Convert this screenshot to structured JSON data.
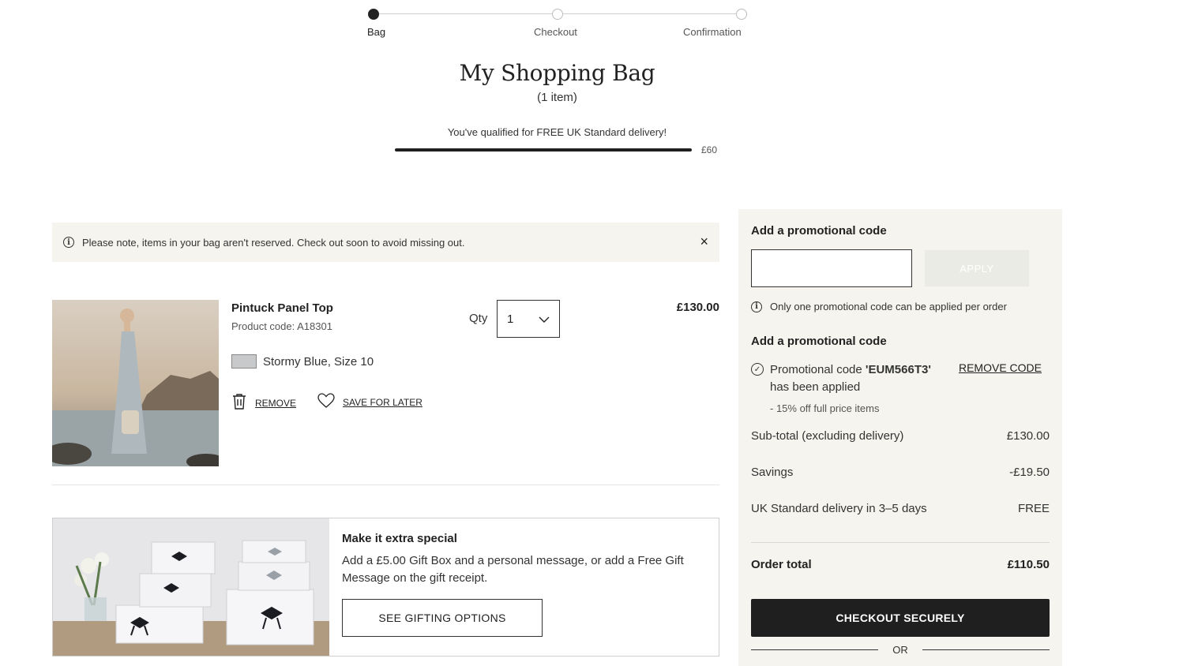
{
  "steps": [
    {
      "label": "Bag",
      "active": true
    },
    {
      "label": "Checkout",
      "active": false
    },
    {
      "label": "Confirmation",
      "active": false
    }
  ],
  "page": {
    "title": "My Shopping Bag",
    "item_count": "(1 item)"
  },
  "delivery": {
    "message": "You've qualified for FREE UK Standard delivery!",
    "threshold": "£60",
    "progress": 1.0
  },
  "notice": {
    "text": "Please note, items in your bag aren't reserved. Check out soon to avoid missing out.",
    "close_symbol": "×"
  },
  "product": {
    "name": "Pintuck Panel Top",
    "code": "Product code: A18301",
    "variant": "Stormy Blue, Size 10",
    "swatch_color": "#c7c9cb",
    "qty_label": "Qty",
    "qty_value": "1",
    "price": "£130.00",
    "remove_label": "REMOVE",
    "save_label": "SAVE FOR LATER"
  },
  "gift": {
    "title": "Make it extra special",
    "description": "Add a £5.00 Gift Box and a personal message, or add a Free Gift Message on the gift receipt.",
    "button_label": "SEE GIFTING OPTIONS"
  },
  "summary": {
    "promo_heading": "Add a promotional code",
    "promo_placeholder": "",
    "apply_label": "APPLY",
    "promo_note": "Only one promotional code can be applied per order",
    "applied_heading": "Add a promotional code",
    "applied_prefix": "Promotional code ",
    "applied_code": "'EUM566T3'",
    "applied_suffix": "has been applied",
    "remove_code_label": "REMOVE CODE",
    "discount_note": "- 15% off full price items",
    "rows": [
      {
        "label": "Sub-total (excluding delivery)",
        "value": "£130.00"
      },
      {
        "label": "Savings",
        "value": "-£19.50"
      },
      {
        "label": "UK Standard delivery in 3–5 days",
        "value": "FREE"
      }
    ],
    "total_label": "Order total",
    "total_value": "£110.50",
    "checkout_label": "CHECKOUT SECURELY",
    "or_label": "OR"
  },
  "colors": {
    "accent": "#1f1f1f",
    "panel_bg": "#f5f4ee"
  }
}
